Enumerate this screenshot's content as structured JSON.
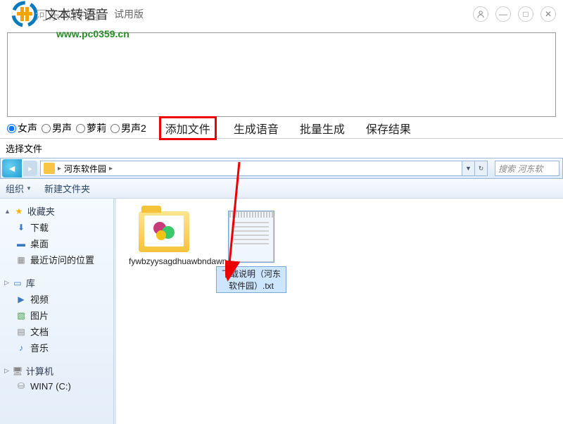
{
  "header": {
    "watermark_title": "河东软件园",
    "app_title": "文本转语音",
    "trial": "试用版",
    "watermark_url": "www.pc0359.cn"
  },
  "voices": {
    "v1": "女声",
    "v2": "男声",
    "v3": "萝莉",
    "v4": "男声2"
  },
  "toolbar": {
    "add_file": "添加文件",
    "gen_audio": "生成语音",
    "batch_gen": "批量生成",
    "save_result": "保存结果"
  },
  "dialog": {
    "title": "选择文件",
    "breadcrumb_item": "河东软件园",
    "search_placeholder": "搜索 河东软",
    "organize": "组织",
    "new_folder": "新建文件夹"
  },
  "sidebar": {
    "favorites": "收藏夹",
    "downloads": "下载",
    "desktop": "桌面",
    "recent": "最近访问的位置",
    "libraries": "库",
    "videos": "视频",
    "pictures": "图片",
    "documents": "文档",
    "music": "音乐",
    "computer": "计算机",
    "drive": "WIN7 (C:)"
  },
  "files": {
    "folder1": "fywbzyysagdhuawbndawn",
    "file1": "下载说明（河东软件园）.txt"
  }
}
